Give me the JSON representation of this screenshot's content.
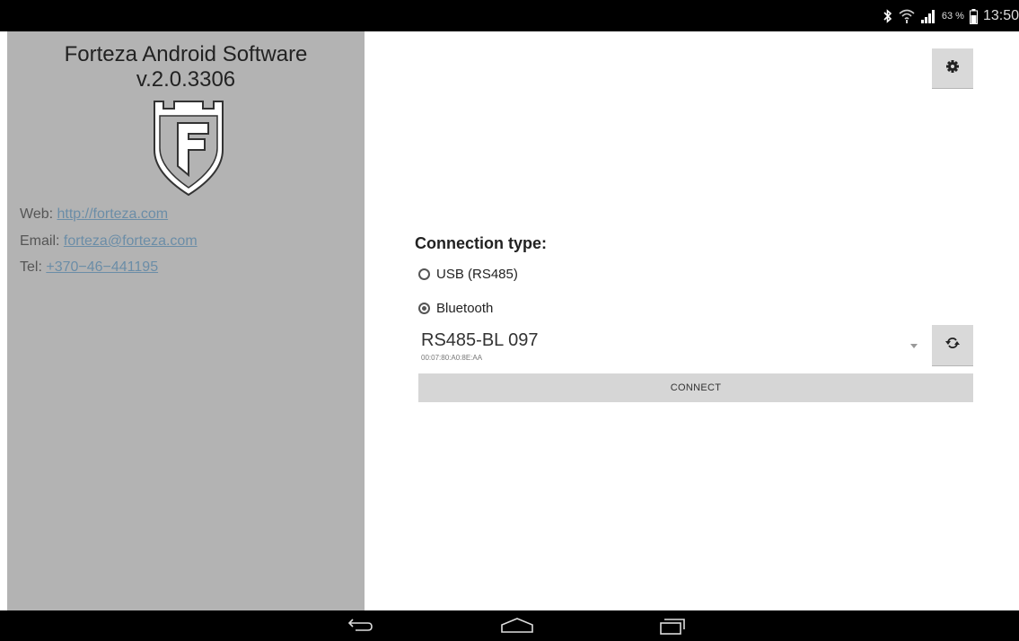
{
  "status_bar": {
    "icons": [
      "bluetooth-icon",
      "wifi-icon",
      "signal-icon",
      "battery-icon"
    ],
    "battery": "63 %",
    "time": "13:50"
  },
  "sidebar": {
    "title_line1": "Forteza Android Software",
    "title_line2": "v.2.0.3306",
    "web_label": "Web:",
    "web_link": "http://forteza.com",
    "email_label": "Email:",
    "email_link": "forteza@forteza.com",
    "tel_label": "Tel:",
    "tel_link": "+370−46−441195"
  },
  "main": {
    "settings_icon": "gear-icon",
    "connection_label": "Connection type:",
    "options": [
      {
        "label": "USB (RS485)",
        "checked": false
      },
      {
        "label": "Bluetooth",
        "checked": true
      }
    ],
    "device": {
      "name": "RS485-BL 097",
      "mac": "00:07:80:A0:8E:AA"
    },
    "refresh_icon": "refresh-icon",
    "connect_label": "CONNECT"
  },
  "nav_bar": {
    "buttons": [
      "back-icon",
      "home-icon",
      "recents-icon"
    ]
  },
  "colors": {
    "sidebar_bg": "#b3b3b3",
    "link": "#6b8da7",
    "button_bg": "#d6d6d6"
  }
}
